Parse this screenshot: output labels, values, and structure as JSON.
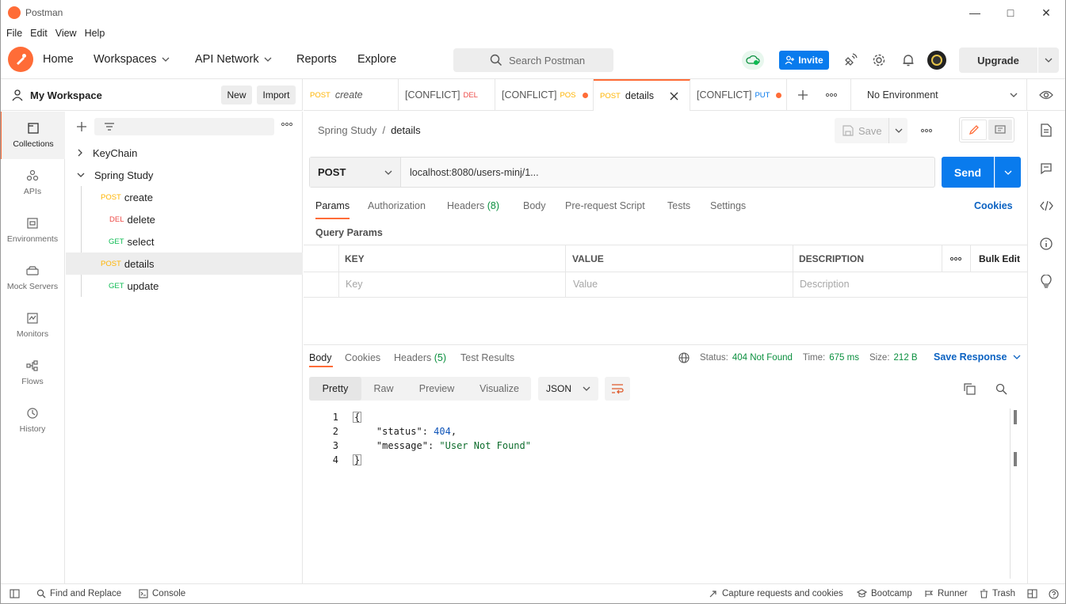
{
  "window": {
    "title": "Postman"
  },
  "menu": [
    "File",
    "Edit",
    "View",
    "Help"
  ],
  "header": {
    "nav": {
      "home": "Home",
      "workspaces": "Workspaces",
      "api_network": "API Network",
      "reports": "Reports",
      "explore": "Explore"
    },
    "search_placeholder": "Search Postman",
    "invite": "Invite",
    "upgrade": "Upgrade"
  },
  "rail": [
    "Collections",
    "APIs",
    "Environments",
    "Mock Servers",
    "Monitors",
    "Flows",
    "History"
  ],
  "workspace": {
    "title": "My Workspace",
    "new": "New",
    "import": "Import"
  },
  "tree": {
    "collections": [
      {
        "name": "KeyChain"
      },
      {
        "name": "Spring Study"
      }
    ],
    "requests": [
      {
        "method": "POST",
        "name": "create"
      },
      {
        "method": "DEL",
        "name": "delete"
      },
      {
        "method": "GET",
        "name": "select"
      },
      {
        "method": "POST",
        "name": "details"
      },
      {
        "method": "GET",
        "name": "update"
      }
    ]
  },
  "tabs": [
    {
      "method": "POST",
      "name": "create"
    },
    {
      "prefix": "[CONFLICT]",
      "method": "DEL"
    },
    {
      "prefix": "[CONFLICT]",
      "method": "POS"
    },
    {
      "method": "POST",
      "name": "details"
    },
    {
      "prefix": "[CONFLICT]",
      "method": "PUT"
    }
  ],
  "environment": "No Environment",
  "request": {
    "breadcrumb_parent": "Spring Study",
    "breadcrumb_sep": "/",
    "breadcrumb_current": "details",
    "save": "Save",
    "method": "POST",
    "url": "localhost:8080/users-minj/1...",
    "send": "Send",
    "tabs": [
      "Params",
      "Authorization",
      "Headers",
      "(8)",
      "Body",
      "Pre-request Script",
      "Tests",
      "Settings"
    ],
    "cookies": "Cookies",
    "query_params": "Query Params",
    "table": {
      "headers": [
        "KEY",
        "VALUE",
        "DESCRIPTION"
      ],
      "bulk_edit": "Bulk Edit",
      "placeholders": [
        "Key",
        "Value",
        "Description"
      ]
    }
  },
  "response": {
    "tabs": [
      "Body",
      "Cookies",
      "Headers",
      "(5)",
      "Test Results"
    ],
    "status_label": "Status:",
    "status_value": "404 Not Found",
    "time_label": "Time:",
    "time_value": "675 ms",
    "size_label": "Size:",
    "size_value": "212 B",
    "save_response": "Save Response",
    "views": [
      "Pretty",
      "Raw",
      "Preview",
      "Visualize"
    ],
    "format": "JSON",
    "line_numbers": [
      "1",
      "2",
      "3",
      "4"
    ],
    "body": {
      "open": "{",
      "key1": "\"status\"",
      "val1": "404",
      "key2": "\"message\"",
      "val2": "\"User Not Found\"",
      "close": "}"
    }
  },
  "statusbar": {
    "find_replace": "Find and Replace",
    "console": "Console",
    "capture": "Capture requests and cookies",
    "bootcamp": "Bootcamp",
    "runner": "Runner",
    "trash": "Trash"
  }
}
